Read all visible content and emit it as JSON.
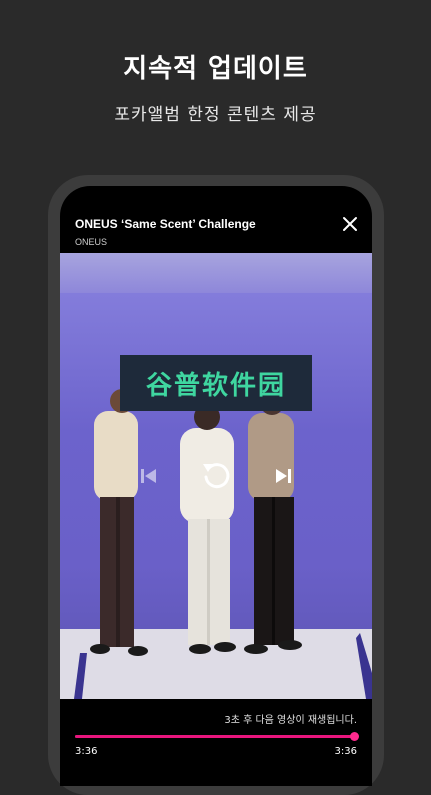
{
  "promo": {
    "title": "지속적 업데이트",
    "subtitle": "포카앨범 한정 콘텐츠 제공"
  },
  "player": {
    "title": "ONEUS ‘Same Scent’ Challenge",
    "artist": "ONEUS",
    "watermark_text": "谷普软件园",
    "next_message": "3초 후 다음 영상이 재생됩니다.",
    "current_time": "3:36",
    "total_time": "3:36",
    "progress": 1.0,
    "colors": {
      "accent": "#e8157d",
      "background": "#2a2a2a",
      "video_bg": "#6c63cc"
    },
    "icons": {
      "close": "close-icon",
      "previous": "skip-previous-icon",
      "replay": "replay-icon",
      "next": "skip-next-icon"
    }
  }
}
